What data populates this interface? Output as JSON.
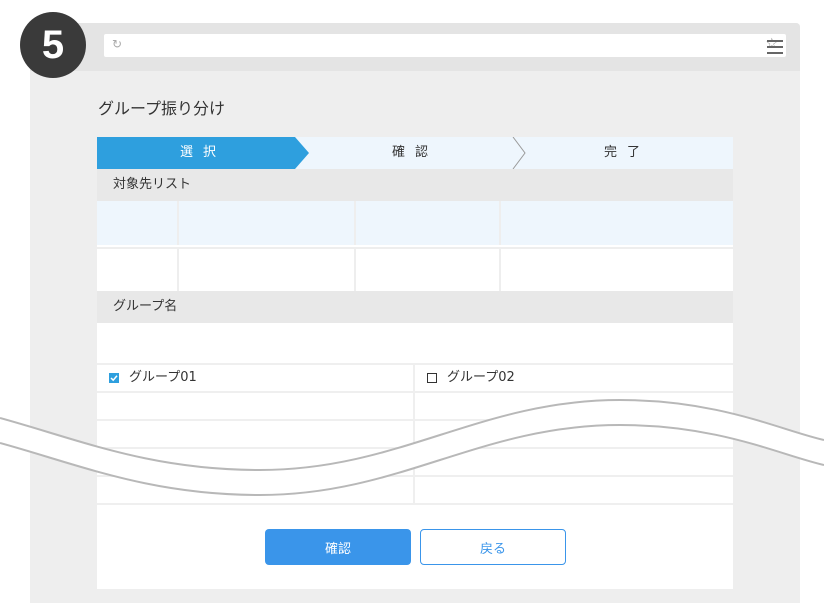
{
  "step_badge": "5",
  "browser": {
    "reload_icon": "reload-icon",
    "star_icon": "star-icon",
    "menu_icon": "hamburger-menu-icon"
  },
  "page": {
    "title": "グループ振り分け"
  },
  "steps": [
    {
      "label": "選択",
      "active": true
    },
    {
      "label": "確認",
      "active": false
    },
    {
      "label": "完了",
      "active": false
    }
  ],
  "target_list": {
    "heading": "対象先リスト"
  },
  "group_name": {
    "heading": "グループ名",
    "options": [
      {
        "label": "グループ01",
        "checked": true
      },
      {
        "label": "グループ02",
        "checked": false
      }
    ]
  },
  "buttons": {
    "confirm_label": "確認",
    "back_label": "戻る"
  },
  "colors": {
    "accent": "#2e9fde",
    "button_primary": "#3a95ea",
    "badge": "#3a3a3a"
  }
}
